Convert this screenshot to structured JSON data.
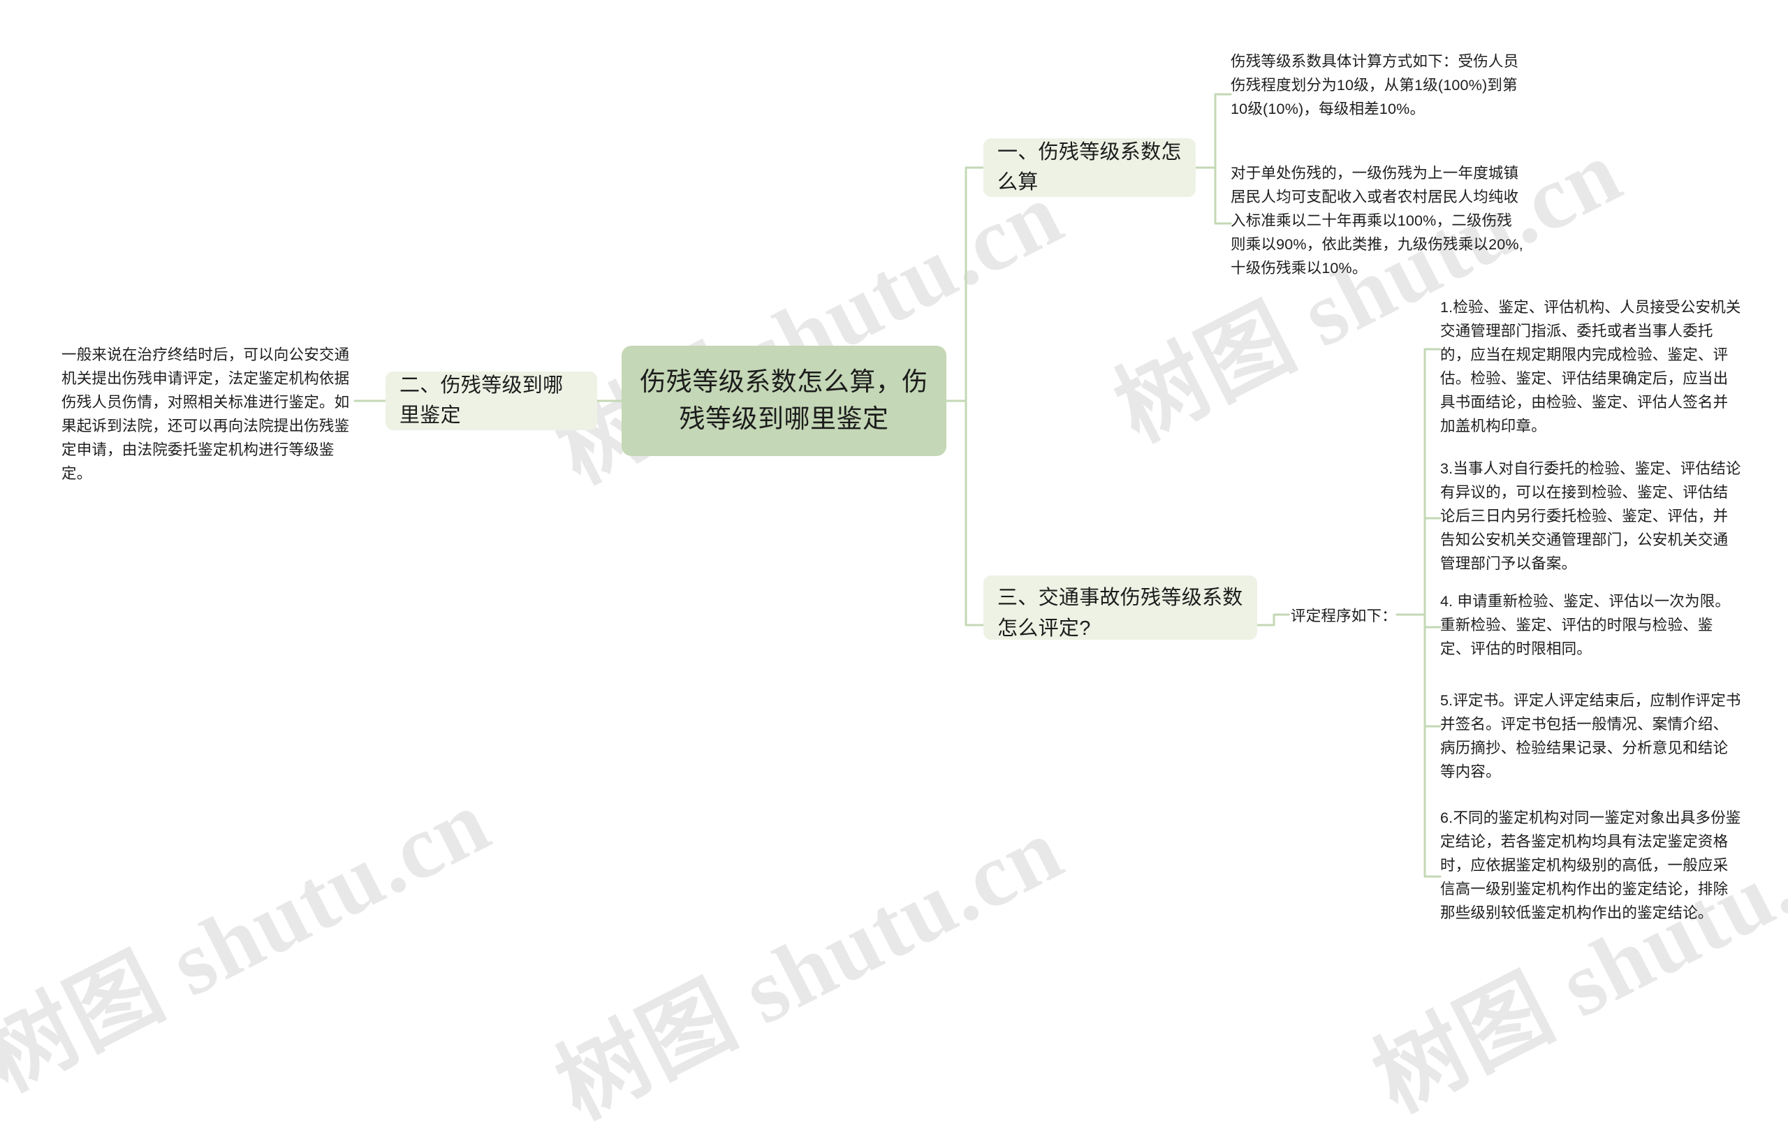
{
  "theme": {
    "canvas_bg": "#ffffff",
    "center_fill": "#c4d7b6",
    "branch_fill": "#edf2e4",
    "connector_stroke": "#c3d8b4",
    "text_color": "#1d1d1d",
    "watermark_color": "#000000"
  },
  "watermark": {
    "text": "树图 shutu.cn",
    "latin": "shutu.cn",
    "cjk": "树图"
  },
  "mindmap": {
    "type": "mindmap",
    "root": {
      "label": "伤残等级系数怎么算，伤残等级到哪里鉴定"
    },
    "branches": [
      {
        "id": "branch-1",
        "label": "一、伤残等级系数怎么算",
        "side": "right",
        "children": [
          {
            "id": "b1-leaf-1",
            "text": "伤残等级系数具体计算方式如下：受伤人员伤残程度划分为10级，从第1级(100%)到第10级(10%)，每级相差10%。"
          },
          {
            "id": "b1-leaf-2",
            "text": "对于单处伤残的，一级伤残为上一年度城镇居民人均可支配收入或者农村居民人均纯收入标准乘以二十年再乘以100%，二级伤残则乘以90%，依此类推，九级伤残乘以20%,十级伤残乘以10%。"
          }
        ]
      },
      {
        "id": "branch-2",
        "label": "二、伤残等级到哪里鉴定",
        "side": "left",
        "children": [
          {
            "id": "b2-leaf-1",
            "text": "一般来说在治疗终结时后，可以向公安交通机关提出伤残申请评定，法定鉴定机构依据伤残人员伤情，对照相关标准进行鉴定。如果起诉到法院，还可以再向法院提出伤残鉴定申请，由法院委托鉴定机构进行等级鉴定。"
          }
        ]
      },
      {
        "id": "branch-3",
        "label": "三、交通事故伤残等级系数怎么评定?",
        "side": "right",
        "intermediate": {
          "id": "b3-mid",
          "label": "评定程序如下："
        },
        "children": [
          {
            "id": "b3-leaf-1",
            "text": "1.检验、鉴定、评估机构、人员接受公安机关交通管理部门指派、委托或者当事人委托的，应当在规定期限内完成检验、鉴定、评估。检验、鉴定、评估结果确定后，应当出具书面结论，由检验、鉴定、评估人签名并加盖机构印章。"
          },
          {
            "id": "b3-leaf-2",
            "text": "3.当事人对自行委托的检验、鉴定、评估结论有异议的，可以在接到检验、鉴定、评估结论后三日内另行委托检验、鉴定、评估，并告知公安机关交通管理部门，公安机关交通管理部门予以备案。"
          },
          {
            "id": "b3-leaf-3",
            "text": "4. 申请重新检验、鉴定、评估以一次为限。重新检验、鉴定、评估的时限与检验、鉴定、评估的时限相同。"
          },
          {
            "id": "b3-leaf-4",
            "text": "5.评定书。评定人评定结束后，应制作评定书并签名。评定书包括一般情况、案情介绍、病历摘抄、检验结果记录、分析意见和结论等内容。"
          },
          {
            "id": "b3-leaf-5",
            "text": "6.不同的鉴定机构对同一鉴定对象出具多份鉴定结论，若各鉴定机构均具有法定鉴定资格时，应依据鉴定机构级别的高低，一般应采信高一级别鉴定机构作出的鉴定结论，排除那些级别较低鉴定机构作出的鉴定结论。"
          }
        ]
      }
    ]
  }
}
